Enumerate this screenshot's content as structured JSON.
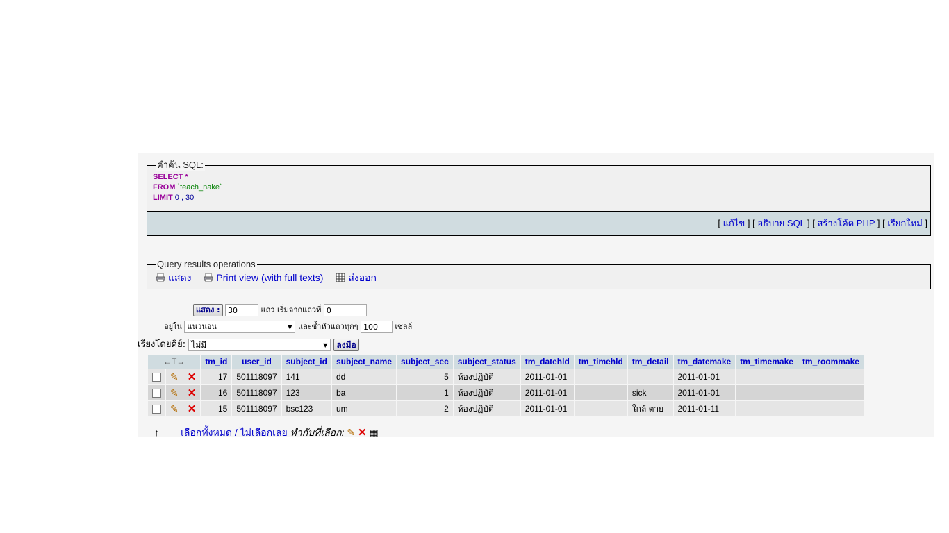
{
  "sql": {
    "legend": "คำค้น SQL:",
    "line1_kw": "SELECT",
    "line1_rest": " *",
    "line2_kw": "FROM",
    "line2_table": " `teach_nake`",
    "line3_kw": "LIMIT",
    "line3_rest": " 0 , 30"
  },
  "sql_links": {
    "edit": "แก้ไข",
    "explain": "อธิบาย SQL",
    "php": "สร้างโค้ด PHP",
    "refresh": "เรียกใหม่"
  },
  "ops": {
    "legend": "Query results operations",
    "print": "แสดง",
    "print_full": "Print view (with full texts)",
    "export": "ส่งออก"
  },
  "nav": {
    "show_button": "แสดง :",
    "rows_value": "30",
    "rows_label": "แถว เริ่มจากแถวที่",
    "start_value": "0",
    "mode_label": "อยู่ใน",
    "mode_value": "แนวนอน",
    "repeat_label": "และซ้ำหัวแถวทุกๆ",
    "repeat_value": "100",
    "cells_label": "เซลล์",
    "sort_label": "เรียงโดยคีย์:",
    "sort_value": "ไม่มี",
    "go_button": "ลงมือ"
  },
  "table": {
    "arrows": "←T→",
    "columns": [
      "tm_id",
      "user_id",
      "subject_id",
      "subject_name",
      "subject_sec",
      "subject_status",
      "tm_datehld",
      "tm_timehld",
      "tm_detail",
      "tm_datemake",
      "tm_timemake",
      "tm_roommake"
    ],
    "rows": [
      {
        "tm_id": "17",
        "user_id": "501118097",
        "subject_id": "141",
        "subject_name": "dd",
        "subject_sec": "5",
        "subject_status": "ห้องปฏิบัติ",
        "tm_datehld": "2011-01-01",
        "tm_timehld": "",
        "tm_detail": "",
        "tm_datemake": "2011-01-01",
        "tm_timemake": "",
        "tm_roommake": ""
      },
      {
        "tm_id": "16",
        "user_id": "501118097",
        "subject_id": "123",
        "subject_name": "ba",
        "subject_sec": "1",
        "subject_status": "ห้องปฏิบัติ",
        "tm_datehld": "2011-01-01",
        "tm_timehld": "",
        "tm_detail": "sick",
        "tm_datemake": "2011-01-01",
        "tm_timemake": "",
        "tm_roommake": ""
      },
      {
        "tm_id": "15",
        "user_id": "501118097",
        "subject_id": "bsc123",
        "subject_name": "um",
        "subject_sec": "2",
        "subject_status": "ห้องปฏิบัติ",
        "tm_datehld": "2011-01-01",
        "tm_timehld": "",
        "tm_detail": "ใกล้ ตาย",
        "tm_datemake": "2011-01-11",
        "tm_timemake": "",
        "tm_roommake": ""
      }
    ]
  },
  "footer": {
    "select_all": "เลือกทั้งหมด / ไม่เลือกเลย",
    "with_selected": "ทำกับที่เลือก:"
  }
}
